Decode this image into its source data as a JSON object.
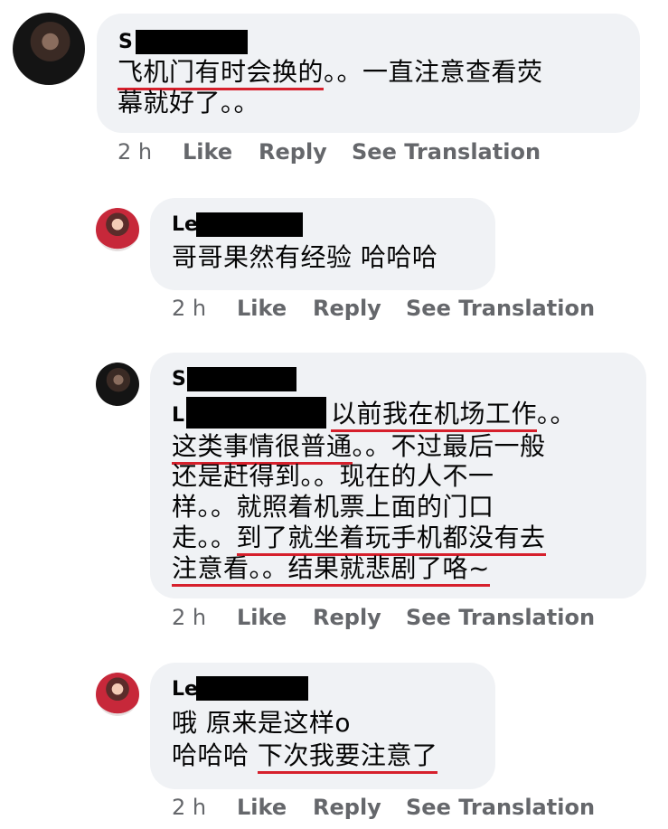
{
  "comments": [
    {
      "name_initial": "S",
      "lines": [
        {
          "u": "飞机门有时会换的",
          "rest": "。。一直注意查看荧"
        },
        {
          "plain": "幕就好了。。"
        }
      ],
      "time": "2 h",
      "like": "Like",
      "reply": "Reply",
      "translate": "See Translation"
    },
    {
      "name_initial": "Le",
      "lines": [
        {
          "plain": "哥哥果然有经验 哈哈哈"
        }
      ],
      "time": "2 h",
      "like": "Like",
      "reply": "Reply",
      "translate": "See Translation"
    },
    {
      "name_initial": "S",
      "mention_initial": "L",
      "lines": [
        {
          "u": "以前我在机场工作",
          "rest": "。。"
        },
        {
          "u": "这类事情很普通",
          "rest": "。。不过最后一般"
        },
        {
          "plain": "还是赶得到。。现在的人不一"
        },
        {
          "plain": "样。。就照着机票上面的门口"
        },
        {
          "pre": "走。。",
          "u": "到了就坐着玩手机都没有去"
        },
        {
          "u": "注意看。。结果就悲剧了咯~"
        }
      ],
      "time": "2 h",
      "like": "Like",
      "reply": "Reply",
      "translate": "See Translation"
    },
    {
      "name_initial": "Le",
      "lines": [
        {
          "plain": "哦 原来是这样o"
        },
        {
          "pre": "哈哈哈 ",
          "u": "下次我要注意了"
        }
      ],
      "time": "2 h",
      "like": "Like",
      "reply": "Reply",
      "translate": "See Translation"
    }
  ],
  "colors": {
    "bubble": "#f0f2f5",
    "underline": "#d6202c",
    "meta": "#65676b"
  }
}
